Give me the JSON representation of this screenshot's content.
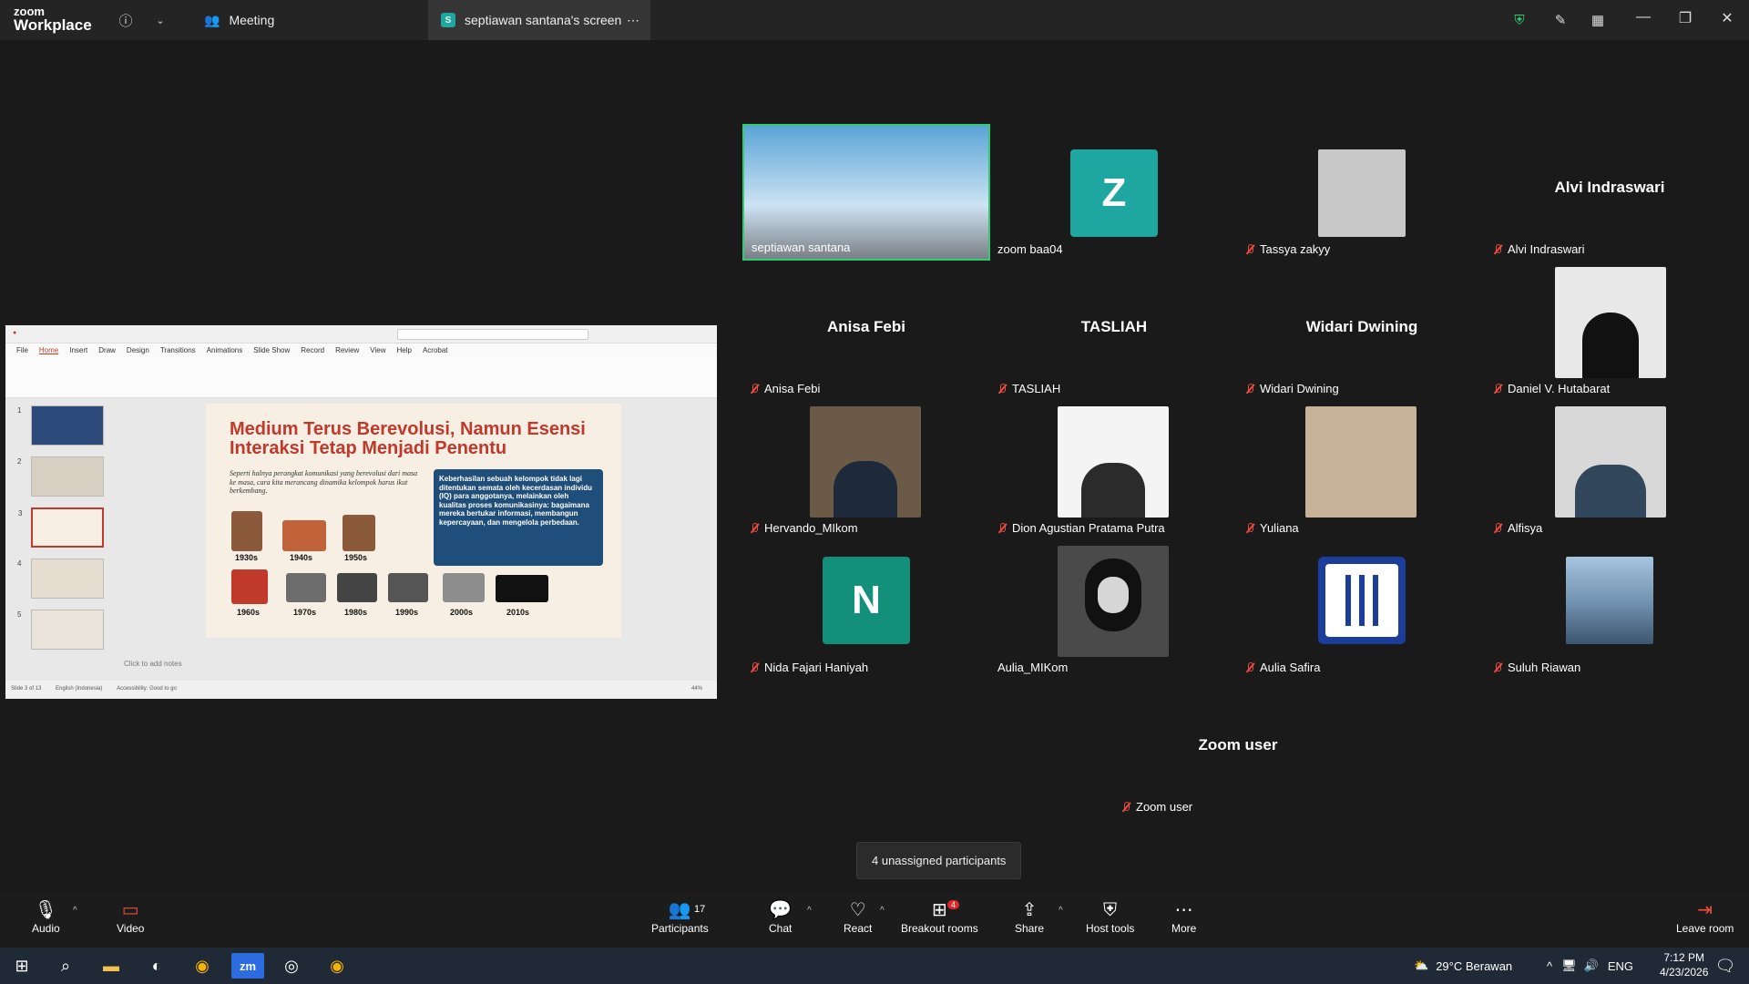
{
  "titlebar": {
    "brand_top": "zoom",
    "brand_bottom": "Workplace",
    "meeting_tab": "Meeting",
    "screen_tab_initial": "S",
    "screen_tab": "septiawan santana's screen"
  },
  "shared_slide": {
    "menu": [
      "File",
      "Home",
      "Insert",
      "Draw",
      "Design",
      "Transitions",
      "Animations",
      "Slide Show",
      "Record",
      "Review",
      "View",
      "Help",
      "Acrobat"
    ],
    "title": "Medium Terus Berevolusi, Namun Esensi Interaksi Tetap Menjadi Penentu",
    "intro": "Seperti halnya perangkat komunikasi yang berevolusi dari masa ke masa, cara kita merancang dinamika kelompok harus ikut berkembang.",
    "box": "Keberhasilan sebuah kelompok tidak lagi ditentukan semata oleh kecerdasan individu (IQ) para anggotanya, melainkan oleh kualitas proses komunikasinya: bagaimana mereka bertukar informasi, membangun kepercayaan, dan mengelola perbedaan.",
    "decades": [
      "1930s",
      "1940s",
      "1950s",
      "1960s",
      "1970s",
      "1980s",
      "1990s",
      "2000s",
      "2010s"
    ],
    "notes": "Click to add notes",
    "status": "Slide 3 of 13",
    "language": "English (Indonesia)",
    "accessibility": "Accessibility: Good to go",
    "zoom": "44%"
  },
  "participants": [
    {
      "name": "septiawan santana",
      "muted": false
    },
    {
      "name": "zoom baa04",
      "muted": false,
      "letter": "Z"
    },
    {
      "name": "Tassya zakyy",
      "muted": true
    },
    {
      "name": "Alvi Indraswari",
      "muted": true
    },
    {
      "name": "Anisa Febi",
      "muted": true
    },
    {
      "name": "TASLIAH",
      "muted": true
    },
    {
      "name": "Widari Dwining",
      "muted": true
    },
    {
      "name": "Daniel V. Hutabarat",
      "muted": true
    },
    {
      "name": "Hervando_MIkom",
      "muted": true
    },
    {
      "name": "Dion Agustian Pratama Putra",
      "muted": true
    },
    {
      "name": "Yuliana",
      "muted": true
    },
    {
      "name": "Alfisya",
      "muted": true
    },
    {
      "name": "Nida Fajari Haniyah",
      "muted": true,
      "letter": "N"
    },
    {
      "name": "Aulia_MIKom",
      "muted": false
    },
    {
      "name": "Aulia Safira",
      "muted": true
    },
    {
      "name": "Suluh Riawan",
      "muted": true
    },
    {
      "name": "Zoom user",
      "muted": true
    }
  ],
  "tooltip": "4 unassigned participants",
  "toolbar": {
    "audio": "Audio",
    "video": "Video",
    "participants": "Participants",
    "participants_count": "17",
    "chat": "Chat",
    "react": "React",
    "breakout": "Breakout rooms",
    "breakout_badge": "4",
    "share": "Share",
    "host_tools": "Host tools",
    "more": "More",
    "leave": "Leave room"
  },
  "taskbar": {
    "weather": "29°C  Berawan",
    "lang": "ENG",
    "time": "7:12 PM",
    "date": "4/23/2026"
  },
  "colors": {
    "active_speaker": "#2ecc71",
    "mute_red": "#e74c3c",
    "teal_avatar": "#1ea7a0"
  }
}
